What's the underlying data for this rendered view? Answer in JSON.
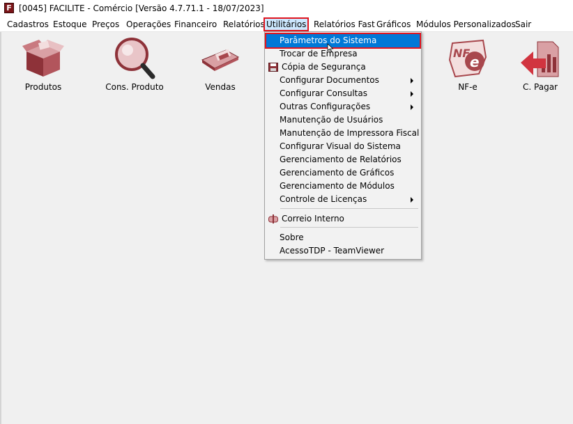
{
  "window": {
    "title": "[0045] FACILITE - Comércio [Versão 4.7.71.1 - 18/07/2023]",
    "app_icon_letter": "F"
  },
  "menubar": {
    "items": [
      {
        "label": "Cadastros"
      },
      {
        "label": "Estoque"
      },
      {
        "label": "Preços"
      },
      {
        "label": "Operações"
      },
      {
        "label": "Financeiro"
      },
      {
        "label": "Relatórios"
      },
      {
        "label": "Utilitários",
        "active": true
      },
      {
        "label": "Relatórios Fast"
      },
      {
        "label": "Gráficos"
      },
      {
        "label": "Módulos Personalizados"
      },
      {
        "label": "Sair"
      }
    ]
  },
  "shortcuts": [
    {
      "label": "Produtos",
      "icon": "box-icon"
    },
    {
      "label": "Cons. Produto",
      "icon": "magnifier-icon"
    },
    {
      "label": "Vendas",
      "icon": "cash-icon"
    },
    {
      "label": "NF-e",
      "icon": "nfe-icon"
    },
    {
      "label": "C. Pagar",
      "icon": "payables-icon"
    }
  ],
  "utilitarios_menu": {
    "items": [
      {
        "label": "Parâmetros do Sistema",
        "highlighted": true
      },
      {
        "label": "Trocar de Empresa"
      },
      {
        "label": "Cópia de Segurança",
        "icon": "floppy-disk-icon"
      },
      {
        "label": "Configurar Documentos",
        "submenu": true
      },
      {
        "label": "Configurar Consultas",
        "submenu": true
      },
      {
        "label": "Outras Configurações",
        "submenu": true
      },
      {
        "label": "Manutenção de Usuários"
      },
      {
        "label": "Manutenção de Impressora Fiscal"
      },
      {
        "label": "Configurar Visual do Sistema"
      },
      {
        "label": "Gerenciamento de Relatórios"
      },
      {
        "label": "Gerenciamento de Gráficos"
      },
      {
        "label": "Gerenciamento de Módulos"
      },
      {
        "label": "Controle de Licenças",
        "submenu": true
      },
      {
        "label": "Correio Interno",
        "icon": "mailbox-icon"
      },
      {
        "label": "Sobre"
      },
      {
        "label": "AcessoTDP - TeamViewer"
      }
    ]
  },
  "colors": {
    "highlight": "#0078d7",
    "callout_border": "#e0141e",
    "icon_primary": "#a8474d"
  }
}
